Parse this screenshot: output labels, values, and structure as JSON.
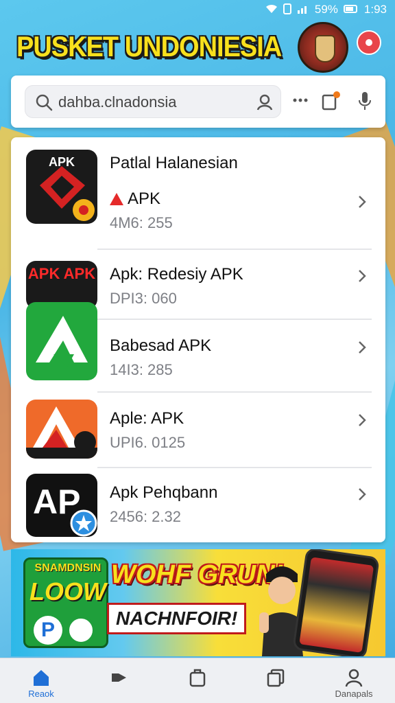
{
  "status_bar": {
    "battery": "59%",
    "time": "1:93"
  },
  "header": {
    "app_title": "PUSKET UNDONIESIA"
  },
  "search": {
    "placeholder": "dahba.clnadonsia",
    "value": "dahba.clnadonsia"
  },
  "apps": [
    {
      "tag": "APK",
      "name": "Patlal Halanesian",
      "subtitle": "APK",
      "meta": "4M6: 255"
    },
    {
      "tag": "APK APK",
      "name": "Apk: Redesiy APK",
      "meta": "DPI3: 060"
    },
    {
      "tag": "",
      "name": "Babesad APK",
      "meta": "14I3: 285"
    },
    {
      "tag": "",
      "name": "Aple: APK",
      "meta": "UPI6. 0125"
    },
    {
      "tag": "",
      "name": "Apk Pehqbann",
      "meta": "2456: 2.32"
    }
  ],
  "banner": {
    "tile_top": "SNAMDNSIN",
    "tile_big": "LOOW",
    "headline": "WOHF GRUN!",
    "subline": "NACHNFOIR!"
  },
  "bottom_nav": [
    {
      "label": "Reaok",
      "icon": "home-icon",
      "active": true
    },
    {
      "label": "",
      "icon": "tag-icon",
      "active": false
    },
    {
      "label": "",
      "icon": "package-icon",
      "active": false
    },
    {
      "label": "",
      "icon": "copy-icon",
      "active": false
    },
    {
      "label": "Danapals",
      "icon": "profile-icon",
      "active": false
    }
  ],
  "colors": {
    "accent": "#1f6fd6",
    "title_yellow": "#f8e01d",
    "background_blue": "#4ab6e6"
  }
}
